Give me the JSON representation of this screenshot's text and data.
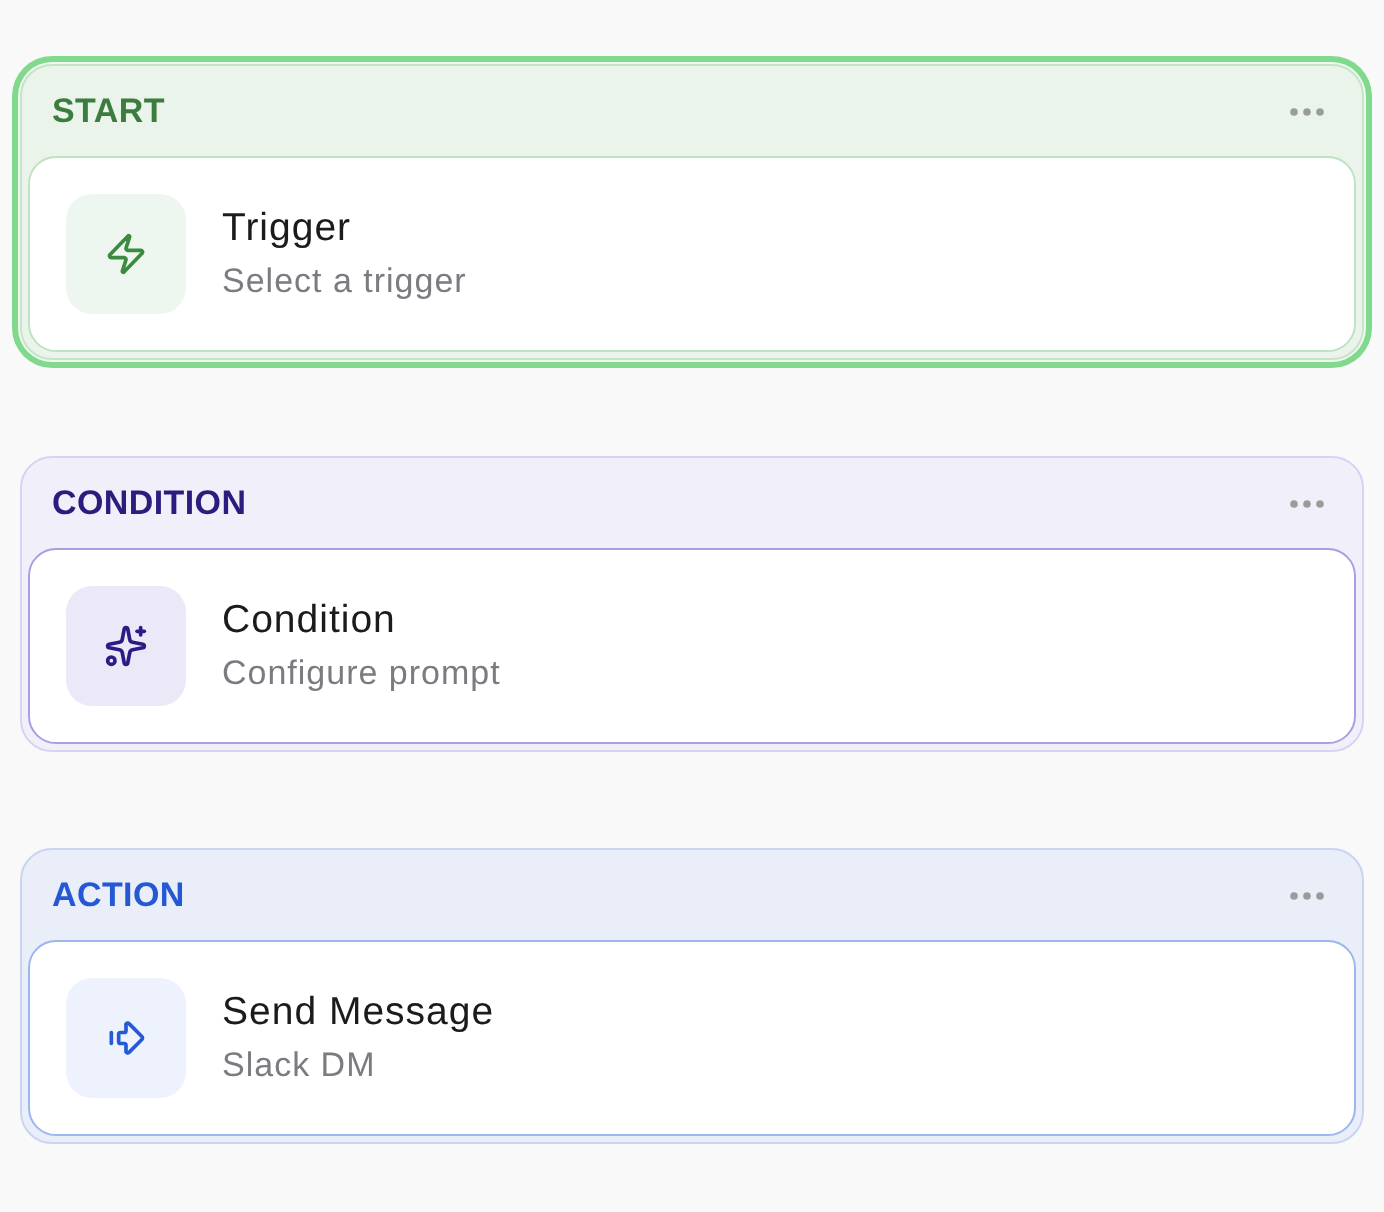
{
  "blocks": [
    {
      "kind": "start",
      "label": "START",
      "selected": true,
      "node": {
        "title": "Trigger",
        "subtitle": "Select a trigger"
      }
    },
    {
      "kind": "condition",
      "label": "CONDITION",
      "selected": false,
      "node": {
        "title": "Condition",
        "subtitle": "Configure prompt"
      }
    },
    {
      "kind": "action",
      "label": "ACTION",
      "selected": false,
      "node": {
        "title": "Send Message",
        "subtitle": "Slack DM"
      }
    }
  ]
}
